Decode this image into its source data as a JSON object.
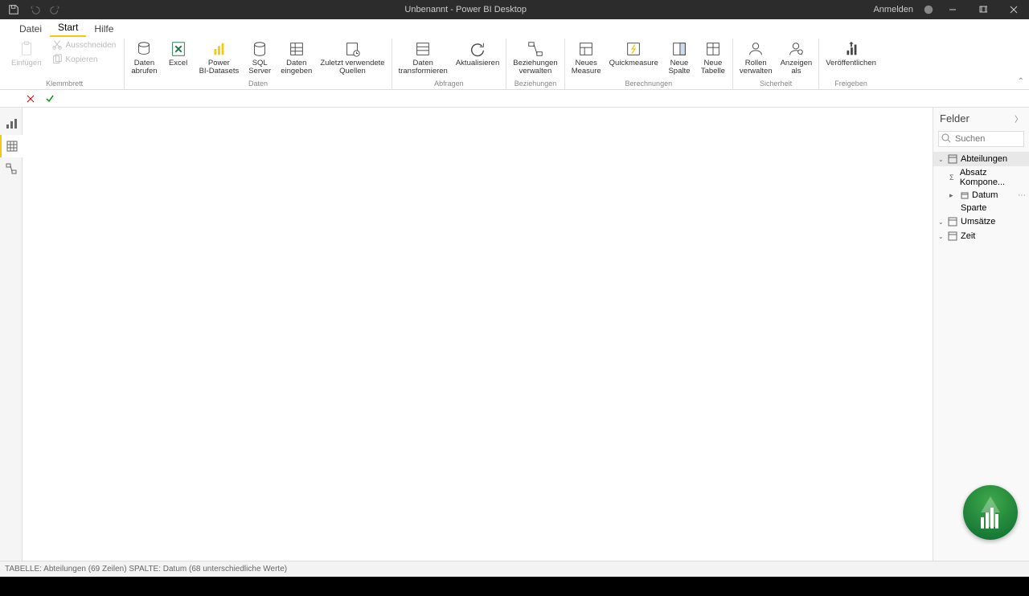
{
  "titlebar": {
    "title": "Unbenannt - Power BI Desktop",
    "signin": "Anmelden"
  },
  "menu": {
    "datei": "Datei",
    "start": "Start",
    "hilfe": "Hilfe"
  },
  "ribbon": {
    "klemmbrett": {
      "label": "Klemmbrett",
      "einfuegen": "Einfügen",
      "ausschneiden": "Ausschneiden",
      "kopieren": "Kopieren"
    },
    "daten": {
      "label": "Daten",
      "abrufen": "Daten\nabrufen",
      "excel": "Excel",
      "pbids": "Power\nBI-Datasets",
      "sql": "SQL\nServer",
      "eingeben": "Daten\neingeben",
      "zuletzt": "Zuletzt verwendete\nQuellen"
    },
    "abfragen": {
      "label": "Abfragen",
      "transform": "Daten\ntransformieren",
      "aktual": "Aktualisieren"
    },
    "beziehungen": {
      "label": "Beziehungen",
      "verwalten": "Beziehungen\nverwalten"
    },
    "berechnungen": {
      "label": "Berechnungen",
      "neues_measure": "Neues\nMeasure",
      "quick": "Quickmeasure",
      "spalte": "Neue\nSpalte",
      "tabelle": "Neue\nTabelle"
    },
    "sicherheit": {
      "label": "Sicherheit",
      "rollen": "Rollen\nverwalten",
      "anzeigen": "Anzeigen\nals"
    },
    "freigeben": {
      "label": "Freigeben",
      "veroeff": "Veröffentlichen"
    }
  },
  "fields": {
    "title": "Felder",
    "search_placeholder": "Suchen",
    "tables": {
      "abteilungen": "Abteilungen",
      "umsaetze": "Umsätze",
      "zeit": "Zeit"
    },
    "abteilungen_fields": {
      "absatz": "Absatz Kompone...",
      "datum": "Datum",
      "sparte": "Sparte"
    }
  },
  "statusbar": "TABELLE: Abteilungen (69 Zeilen) SPALTE: Datum (68 unterschiedliche Werte)"
}
